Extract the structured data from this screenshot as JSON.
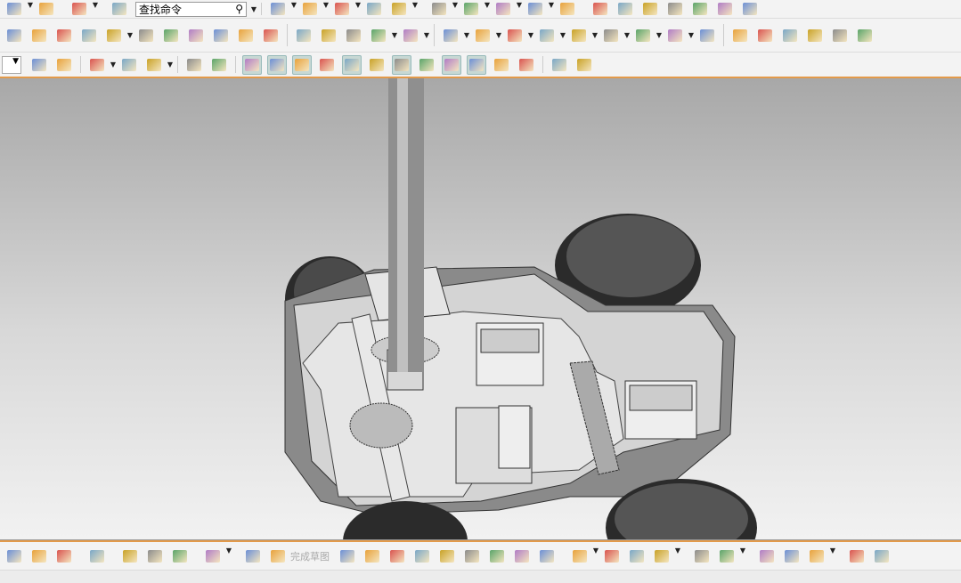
{
  "search": {
    "placeholder": "查找命令",
    "icon": "magnifier-icon"
  },
  "sketch": {
    "finish_label": "完成草图"
  },
  "colors": {
    "accent": "#e39a4a",
    "viewport_top": "#a8a8a8",
    "viewport_bottom": "#f2f2f2"
  },
  "toolbars": {
    "row1_left": [
      "undo-icon",
      "redo-icon",
      "part-nav-icon",
      "info-icon"
    ],
    "row1_right": [
      "fit-view-icon",
      "render-style-icon",
      "cube-view-icon",
      "section-icon",
      "layer-icon",
      "snap-point-icon",
      "analysis-icon",
      "sketch-icon",
      "measure-icon",
      "grid-icon",
      "layers-icon",
      "table-icon",
      "note-icon",
      "check-icon",
      "tool-icon",
      "check-green-icon",
      "text-icon"
    ],
    "row2": [
      "boss-icon",
      "pattern-icon",
      "array-icon",
      "split-body-icon",
      "unite-icon",
      "box-icon",
      "sweep-icon",
      "trim-icon",
      "shell-icon",
      "extract-icon",
      "block-icon",
      "fold-icon",
      "draft-icon",
      "pyramid-icon",
      "gem-icon",
      "move-face-icon",
      "offset-face-icon",
      "delete-face-icon",
      "replace-face-icon",
      "resize-icon",
      "move-icon",
      "copy-face-icon",
      "paste-face-icon",
      "pull-face-icon",
      "surface-icon",
      "mesh-icon",
      "patch-icon",
      "blend-icon",
      "gauge-icon",
      "flange-icon",
      "section-curve-icon"
    ],
    "row3": [
      "filter-icon",
      "select-icon",
      "deselect-icon",
      "move-point-icon",
      "rect-select-icon",
      "face-icon",
      "body-icon",
      "snap-endpoint-icon",
      "snap-midpoint-icon",
      "snap-line-icon",
      "snap-curve-icon",
      "snap-control-icon",
      "snap-intersection-icon",
      "snap-center-icon",
      "snap-quadrant-icon",
      "snap-cross-icon",
      "snap-tangent-icon",
      "snap-surface-icon",
      "grid-snap-icon",
      "frame-icon",
      "view-icon"
    ],
    "bottom_left": [
      "constraint-icon",
      "assembly-icon",
      "component-icon",
      "package-icon",
      "link-icon",
      "chain-icon",
      "tree-info-icon",
      "explode-icon",
      "sketch-frame-icon",
      "finish-flag-icon"
    ],
    "bottom_right": [
      "profile-icon",
      "line-icon",
      "arc-icon",
      "circle-icon",
      "fillet-icon",
      "chamfer-icon",
      "rectangle-icon",
      "polygon-icon",
      "point-icon",
      "offset-curve-icon",
      "trim-curve-icon",
      "extend-curve-icon",
      "corner-icon",
      "mirror-icon",
      "dimension-icon",
      "constraint-dim-icon",
      "geometric-icon",
      "display-icon",
      "relation-icon",
      "convert-icon"
    ]
  }
}
